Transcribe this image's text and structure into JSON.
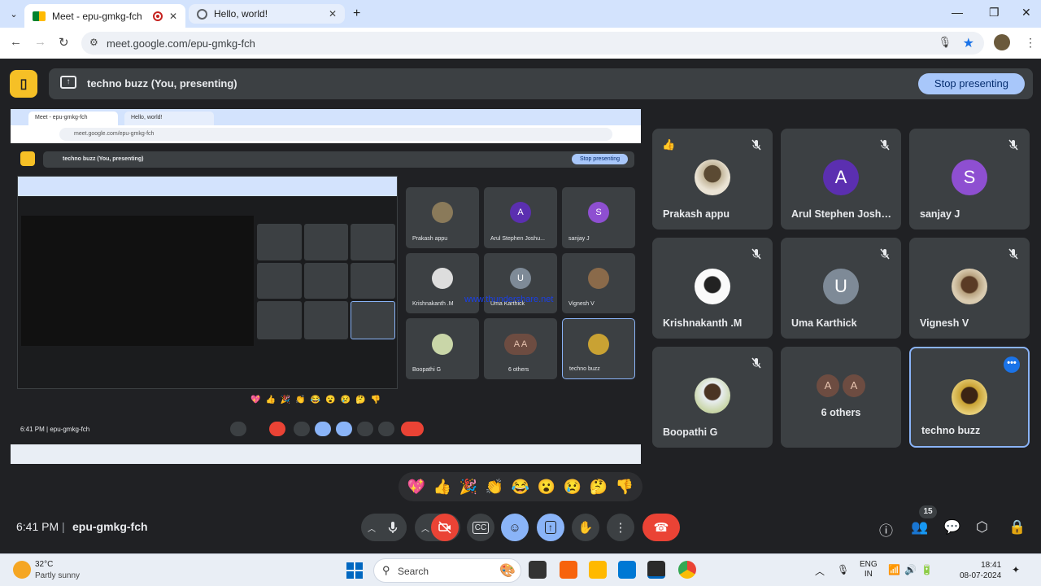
{
  "browser": {
    "tabs": [
      {
        "title": "Meet - epu-gmkg-fch",
        "active": true
      },
      {
        "title": "Hello, world!",
        "active": false
      }
    ],
    "url": "meet.google.com/epu-gmkg-fch"
  },
  "present": {
    "label": "techno buzz (You, presenting)",
    "stop_label": "Stop presenting"
  },
  "shared_screen": {
    "tab1": "Meet - epu-gmkg-fch",
    "tab2": "Hello, world!",
    "url": "meet.google.com/epu-gmkg-fch",
    "present_label": "techno buzz (You, presenting)",
    "stop_label": "Stop presenting",
    "time": "6:41 PM",
    "code": "epu-gmkg-fch",
    "watermark": "www.thundershare.net",
    "tiles": [
      {
        "name": "Prakash appu",
        "initial": ""
      },
      {
        "name": "Arul Stephen Joshu...",
        "initial": "A"
      },
      {
        "name": "sanjay J",
        "initial": "S"
      },
      {
        "name": "Krishnakanth .M",
        "initial": ""
      },
      {
        "name": "Uma Karthick",
        "initial": "U"
      },
      {
        "name": "Vignesh V",
        "initial": ""
      },
      {
        "name": "Boopathi G",
        "initial": ""
      },
      {
        "name": "6 others",
        "initial": "A A"
      },
      {
        "name": "techno buzz",
        "initial": ""
      }
    ]
  },
  "participants": [
    {
      "name": "Prakash appu",
      "type": "photo",
      "reaction": "👍",
      "muted": true
    },
    {
      "name": "Arul Stephen Joshu...",
      "type": "letter",
      "initial": "A",
      "color": "#5b2fb0",
      "muted": true
    },
    {
      "name": "sanjay J",
      "type": "letter",
      "initial": "S",
      "color": "#8e4fd1",
      "muted": true
    },
    {
      "name": "Krishnakanth .M",
      "type": "photo",
      "muted": true
    },
    {
      "name": "Uma Karthick",
      "type": "letter",
      "initial": "U",
      "color": "#7e8a97",
      "muted": true
    },
    {
      "name": "Vignesh V",
      "type": "photo",
      "muted": true
    },
    {
      "name": "Boopathi G",
      "type": "photo",
      "muted": true
    },
    {
      "name": "6 others",
      "type": "others",
      "initials": [
        "A",
        "A"
      ]
    },
    {
      "name": "techno buzz",
      "type": "photo",
      "highlighted": true
    }
  ],
  "reactions": [
    "💖",
    "👍",
    "🎉",
    "👏",
    "😂",
    "😮",
    "😢",
    "🤔",
    "👎"
  ],
  "meeting": {
    "time": "6:41 PM",
    "separator": "|",
    "code": "epu-gmkg-fch",
    "participant_count": "15"
  },
  "taskbar": {
    "temperature": "32°C",
    "condition": "Partly sunny",
    "search_label": "Search",
    "lang_line1": "ENG",
    "lang_line2": "IN",
    "time": "18:41",
    "date": "08-07-2024"
  }
}
